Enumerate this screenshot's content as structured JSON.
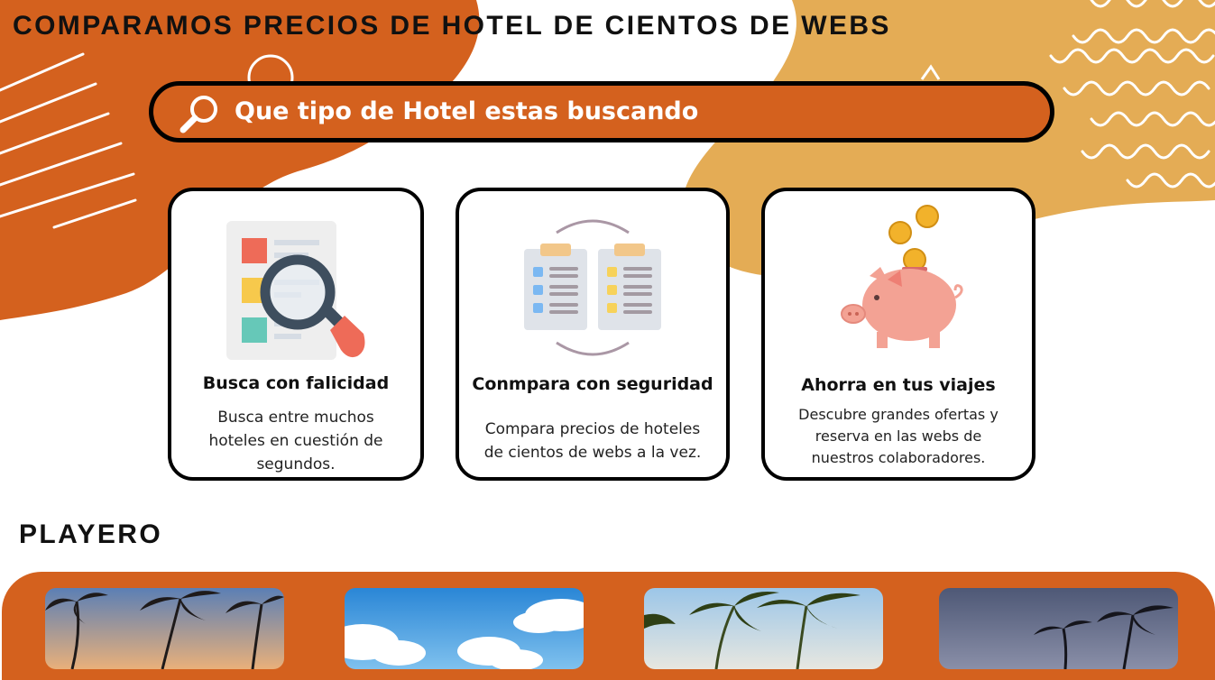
{
  "header": {
    "title": "COMPARAMOS PRECIOS DE HOTEL DE CIENTOS DE WEBS"
  },
  "search": {
    "placeholder": "Que tipo de Hotel estas buscando",
    "icon": "search-icon"
  },
  "features": [
    {
      "icon": "document-search-icon",
      "title": "Busca con falicidad",
      "description": "Busca entre muchos hoteles en cuestión de segundos."
    },
    {
      "icon": "clipboards-compare-icon",
      "title": "Conmpara con seguridad",
      "description": "Compara precios de hoteles de cientos de webs a la vez."
    },
    {
      "icon": "piggy-bank-icon",
      "title": "Ahorra en  tus viajes",
      "description": "Descubre grandes ofertas y reserva en las webs de nuestros colaboradores."
    }
  ],
  "section": {
    "title": "PLAYERO"
  },
  "colors": {
    "accent": "#d4611e",
    "secondary": "#e4ac55",
    "text": "#111111",
    "background": "#ffffff"
  },
  "hotels": [
    {
      "image": "palm-trees-sunset-photo"
    },
    {
      "image": "blue-sky-clouds-photo"
    },
    {
      "image": "palm-trees-blue-sky-photo"
    },
    {
      "image": "palm-trees-dusk-photo"
    }
  ]
}
